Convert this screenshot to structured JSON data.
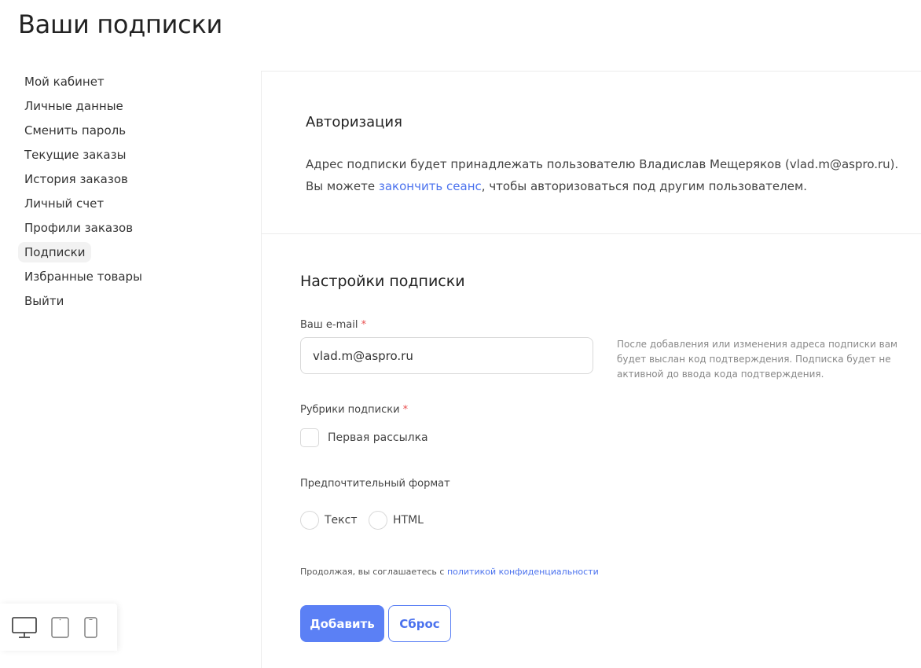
{
  "page": {
    "title": "Ваши подписки"
  },
  "sidebar": {
    "items": [
      {
        "label": "Мой кабинет"
      },
      {
        "label": "Личные данные"
      },
      {
        "label": "Сменить пароль"
      },
      {
        "label": "Текущие заказы"
      },
      {
        "label": "История заказов"
      },
      {
        "label": "Личный счет"
      },
      {
        "label": "Профили заказов"
      },
      {
        "label": "Подписки",
        "active": true
      },
      {
        "label": "Избранные товары"
      },
      {
        "label": "Выйти"
      }
    ]
  },
  "auth": {
    "title": "Авторизация",
    "line1": "Адрес подписки будет принадлежать пользователю Владислав Мещеряков (vlad.m@aspro.ru).",
    "line2_before": "Вы можете ",
    "line2_link": "закончить сеанс",
    "line2_after": ", чтобы авторизоваться под другим пользователем."
  },
  "settings": {
    "title": "Настройки подписки",
    "email_label": "Ваш e-mail",
    "required_mark": "*",
    "email_value": "vlad.m@aspro.ru",
    "hint": "После добавления или изменения адреса подписки вам будет выслан код подтверждения. Подписка будет не активной до ввода кода подтверждения.",
    "rubrics_label": "Рубрики подписки",
    "rubric_option": "Первая рассылка",
    "format_label": "Предпочтительный формат",
    "format_options": [
      {
        "label": "Текст"
      },
      {
        "label": "HTML"
      }
    ],
    "consent_text": "Продолжая, вы соглашаетесь с ",
    "consent_link": "политикой конфиденциальности",
    "submit_label": "Добавить",
    "reset_label": "Сброс"
  },
  "device_switcher": {
    "icons": [
      "desktop-icon",
      "tablet-icon",
      "mobile-icon"
    ]
  },
  "colors": {
    "accent": "#5b80f5",
    "link": "#4b72ee",
    "required": "#e94f4f",
    "active_bg": "#f2f2f2",
    "border": "#d9d9d9"
  }
}
